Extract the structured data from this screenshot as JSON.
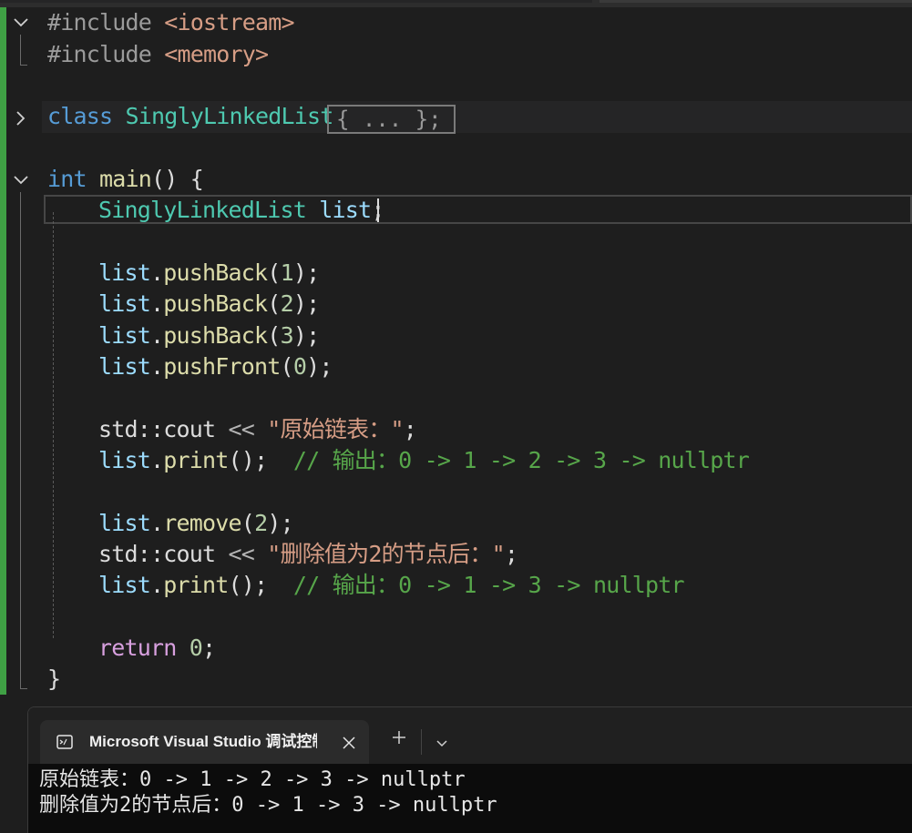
{
  "colors": {
    "background": "#1e1e1e",
    "change_bar": "#3fa044",
    "keyword": "#569cd6",
    "type": "#4ec9b0",
    "identifier": "#9cdcfe",
    "function": "#dcdcaa",
    "number": "#b5cea8",
    "string": "#d69d85",
    "comment": "#57a64a",
    "control": "#d8a0df"
  },
  "code": {
    "l1": {
      "directive": "#include",
      "header": "<iostream>"
    },
    "l2": {
      "directive": "#include",
      "header": "<memory>"
    },
    "l3": {
      "keyword": "class",
      "name": "SinglyLinkedList",
      "collapsed": "{ ... };"
    },
    "l4": {
      "type": "int",
      "fn": "main",
      "rest": "() {"
    },
    "l5": {
      "type": "SinglyLinkedList",
      "var": "list",
      "end": ";"
    },
    "l6": {
      "obj": "list",
      "dot": ".",
      "fn": "pushBack",
      "open": "(",
      "arg": "1",
      "close": ");"
    },
    "l7": {
      "obj": "list",
      "dot": ".",
      "fn": "pushBack",
      "open": "(",
      "arg": "2",
      "close": ");"
    },
    "l8": {
      "obj": "list",
      "dot": ".",
      "fn": "pushBack",
      "open": "(",
      "arg": "3",
      "close": ");"
    },
    "l9": {
      "obj": "list",
      "dot": ".",
      "fn": "pushFront",
      "open": "(",
      "arg": "0",
      "close": ");"
    },
    "l10": {
      "stream": "std::cout",
      "op": " << ",
      "str": "\"原始链表：\"",
      "end": ";"
    },
    "l11": {
      "obj": "list",
      "dot": ".",
      "fn": "print",
      "call": "();",
      "comment": "  // 输出：0 -> 1 -> 2 -> 3 -> nullptr"
    },
    "l12": {
      "obj": "list",
      "dot": ".",
      "fn": "remove",
      "open": "(",
      "arg": "2",
      "close": ");"
    },
    "l13": {
      "stream": "std::cout",
      "op": " << ",
      "str": "\"删除值为2的节点后：\"",
      "end": ";"
    },
    "l14": {
      "obj": "list",
      "dot": ".",
      "fn": "print",
      "call": "();",
      "comment": "  // 输出：0 -> 1 -> 3 -> nullptr"
    },
    "l15": {
      "keyword": "return",
      "num": "0",
      "end": ";"
    },
    "l16": {
      "brace": "}"
    }
  },
  "terminal": {
    "tab_title": "Microsoft Visual Studio 调试控制台",
    "icon": "console-icon",
    "output": [
      "原始链表：0 -> 1 -> 2 -> 3 -> nullptr",
      "删除值为2的节点后：0 -> 1 -> 3 -> nullptr"
    ]
  }
}
